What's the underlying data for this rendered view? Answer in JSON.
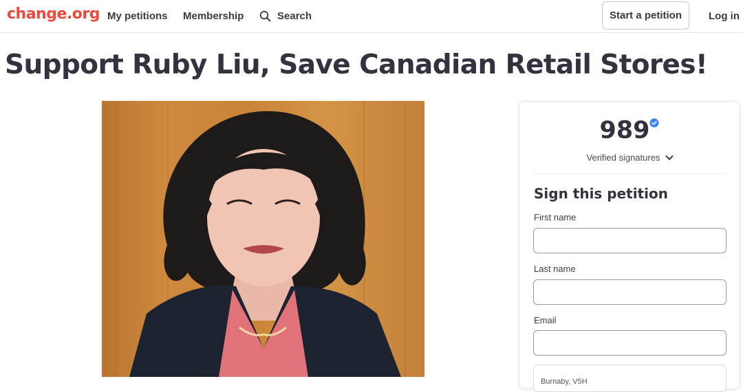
{
  "header": {
    "logo": "change.org",
    "nav": {
      "my_petitions": "My petitions",
      "membership": "Membership",
      "search": "Search"
    },
    "start_petition": "Start a petition",
    "login": "Log in"
  },
  "petition": {
    "title": "Support Ruby Liu, Save Canadian Retail Stores!"
  },
  "panel": {
    "signature_count": "989",
    "signature_label": "Verified signatures",
    "sign_heading": "Sign this petition",
    "fields": {
      "first_name_label": "First name",
      "last_name_label": "Last name",
      "email_label": "Email",
      "location_value": "Burnaby, V5H"
    }
  },
  "colors": {
    "brand": "#eb4b3c",
    "verified": "#3b82f6",
    "text_dark": "#34323f"
  },
  "icons": {
    "search": "search-icon",
    "verified": "verified-check-icon",
    "chevron": "chevron-down-icon"
  }
}
